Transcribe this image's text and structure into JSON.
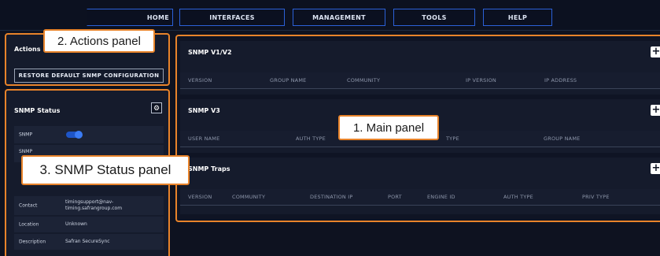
{
  "nav": {
    "home": "HOME",
    "interfaces": "INTERFACES",
    "management": "MANAGEMENT",
    "tools": "TOOLS",
    "help": "HELP"
  },
  "actions": {
    "title": "Actions",
    "restore_label": "RESTORE DEFAULT SNMP CONFIGURATION"
  },
  "status": {
    "title": "SNMP Status",
    "rows": {
      "snmp": {
        "label": "SNMP",
        "enabled": true
      },
      "snmp2": {
        "label": "SNMP"
      },
      "contact": {
        "label": "Contact",
        "value_line1": "timingsupport@nav-",
        "value_line2": "timing.safrangroup.com"
      },
      "location": {
        "label": "Location",
        "value": "Unknown"
      },
      "description": {
        "label": "Description",
        "value": "Safran SecureSync"
      }
    }
  },
  "main": {
    "v1v2": {
      "title": "SNMP V1/V2",
      "columns": [
        "VERSION",
        "GROUP NAME",
        "COMMUNITY",
        "IP VERSION",
        "IP ADDRESS"
      ]
    },
    "v3": {
      "title": "SNMP V3",
      "columns": [
        "USER NAME",
        "AUTH TYPE",
        "TYPE",
        "GROUP NAME"
      ]
    },
    "traps": {
      "title": "SNMP Traps",
      "columns": [
        "VERSION",
        "COMMUNITY",
        "DESTINATION IP",
        "PORT",
        "ENGINE ID",
        "AUTH TYPE",
        "PRIV TYPE"
      ]
    },
    "add_symbol": "+"
  },
  "callouts": {
    "actions": "2. Actions panel",
    "main": "1. Main panel",
    "status": "3. SNMP Status panel"
  },
  "colors": {
    "accent_blue": "#2b61d8",
    "highlight_orange": "#e8832a",
    "background": "#0e1220"
  },
  "icons": {
    "settings": "gear-icon",
    "add": "plus-icon"
  }
}
